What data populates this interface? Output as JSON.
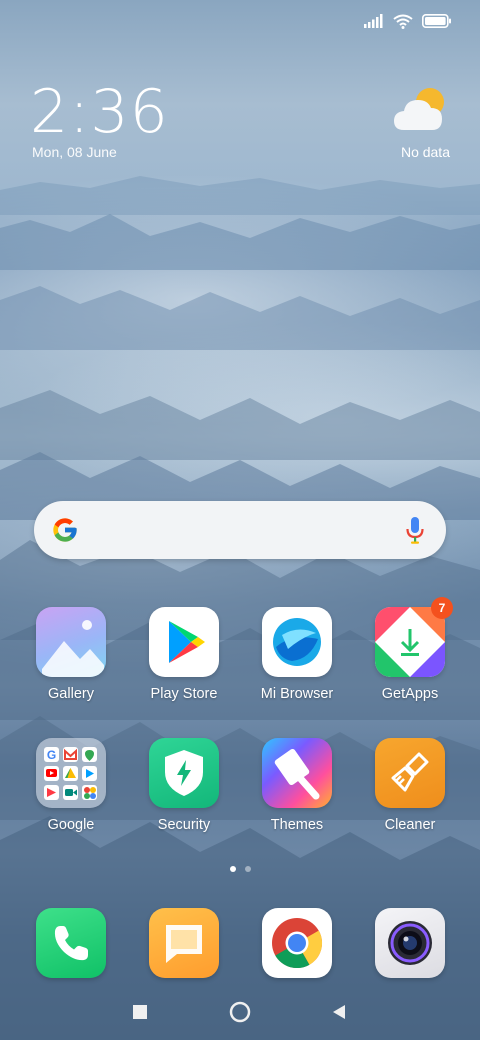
{
  "clock": {
    "time": "2:36",
    "date": "Mon, 08 June"
  },
  "weather": {
    "status": "No data",
    "icon": "partly-cloudy-icon"
  },
  "status_bar": {
    "icons": [
      "signal-icon",
      "wifi-icon",
      "battery-icon"
    ]
  },
  "search": {
    "icon": "google-logo-icon",
    "mic_icon": "microphone-icon"
  },
  "apps": [
    {
      "label": "Gallery",
      "icon": "gallery-icon"
    },
    {
      "label": "Play Store",
      "icon": "play-store-icon"
    },
    {
      "label": "Mi Browser",
      "icon": "mi-browser-icon"
    },
    {
      "label": "GetApps",
      "icon": "getapps-icon",
      "badge": "7"
    },
    {
      "label": "Google",
      "icon": "google-folder-icon"
    },
    {
      "label": "Security",
      "icon": "security-icon"
    },
    {
      "label": "Themes",
      "icon": "themes-icon"
    },
    {
      "label": "Cleaner",
      "icon": "cleaner-icon"
    }
  ],
  "dock": [
    {
      "icon": "phone-icon"
    },
    {
      "icon": "messages-icon"
    },
    {
      "icon": "chrome-icon"
    },
    {
      "icon": "camera-icon"
    }
  ],
  "page_indicator": {
    "pages": 2,
    "current": 1
  },
  "nav": {
    "icons": [
      "recents-icon",
      "home-icon",
      "back-icon"
    ]
  }
}
